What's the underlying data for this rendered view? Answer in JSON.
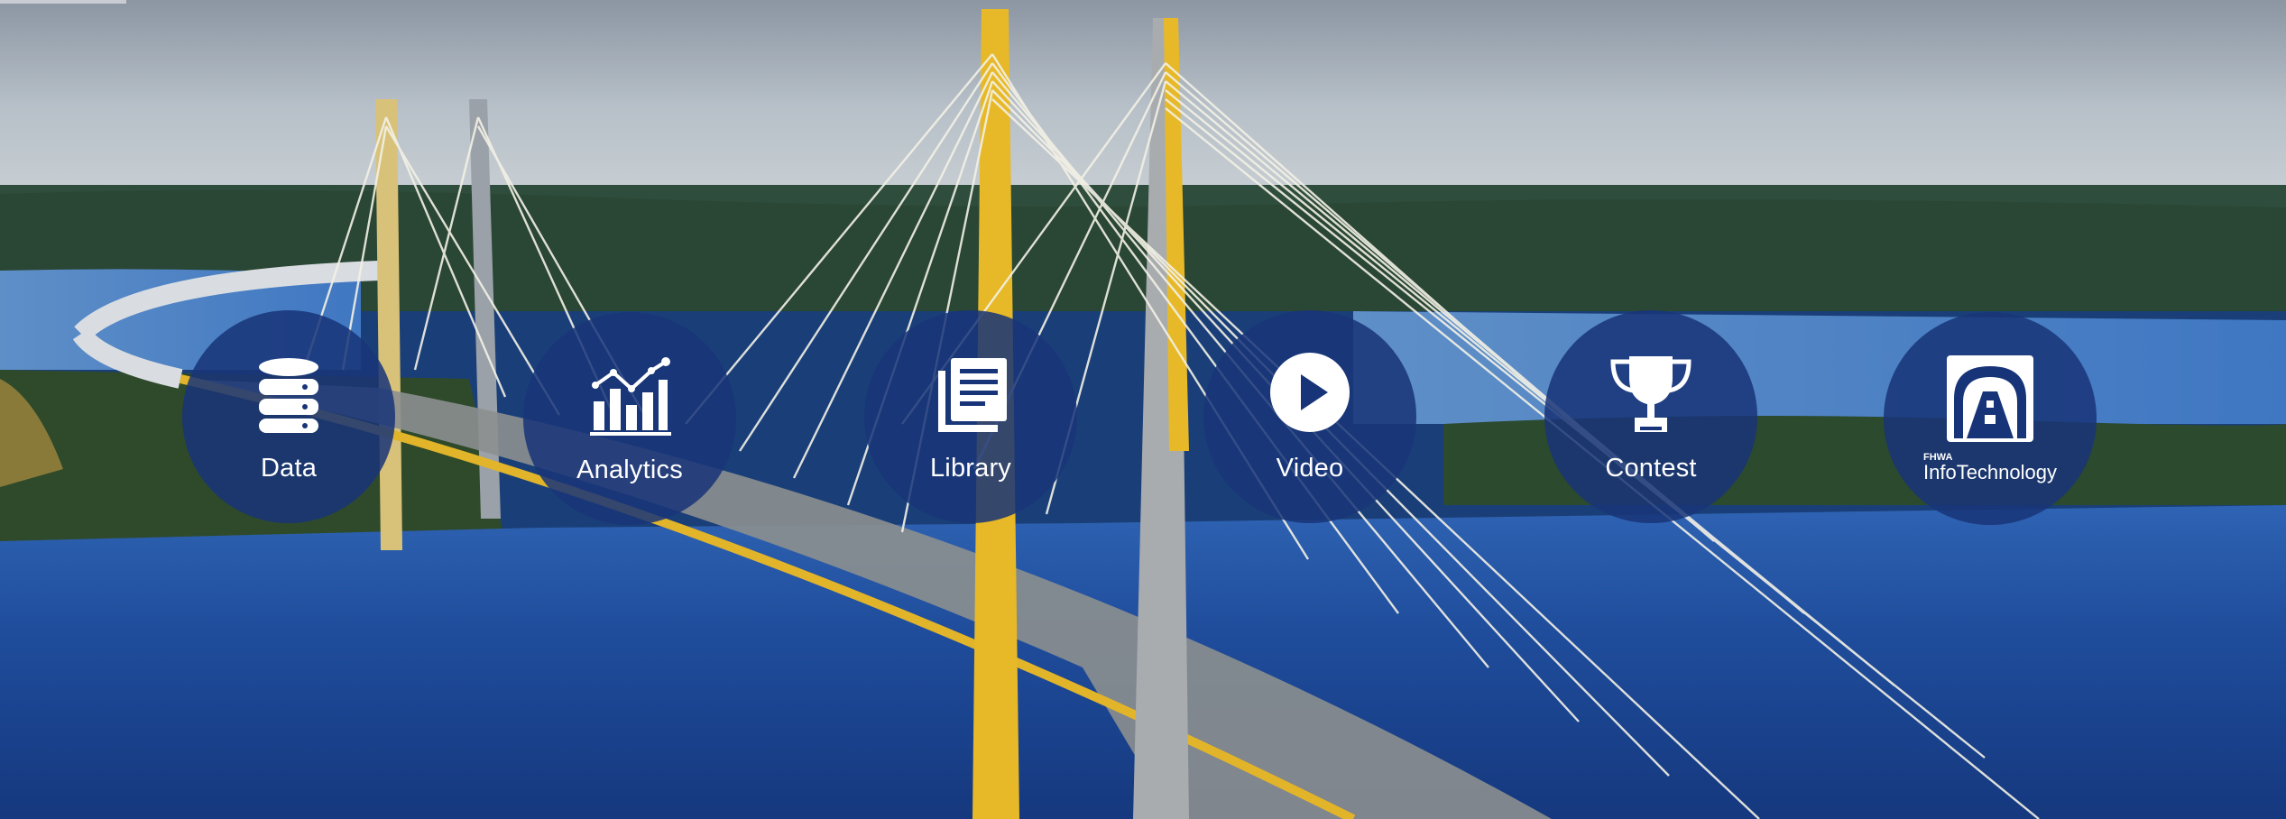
{
  "hero": {
    "background": "cable-stayed-bridge-over-river-photo",
    "colors": {
      "circle_fill": "#183478",
      "icon_color": "#ffffff",
      "tower_yellow": "#e7b928"
    }
  },
  "nav": [
    {
      "id": "data",
      "label": "Data",
      "icon": "database-icon"
    },
    {
      "id": "analytics",
      "label": "Analytics",
      "icon": "bar-line-chart-icon"
    },
    {
      "id": "library",
      "label": "Library",
      "icon": "documents-icon"
    },
    {
      "id": "video",
      "label": "Video",
      "icon": "play-icon"
    },
    {
      "id": "contest",
      "label": "Contest",
      "icon": "trophy-icon"
    },
    {
      "id": "infotech",
      "label_small": "FHWA",
      "label": "InfoTechnology",
      "icon": "road-tunnel-logo-icon"
    }
  ]
}
